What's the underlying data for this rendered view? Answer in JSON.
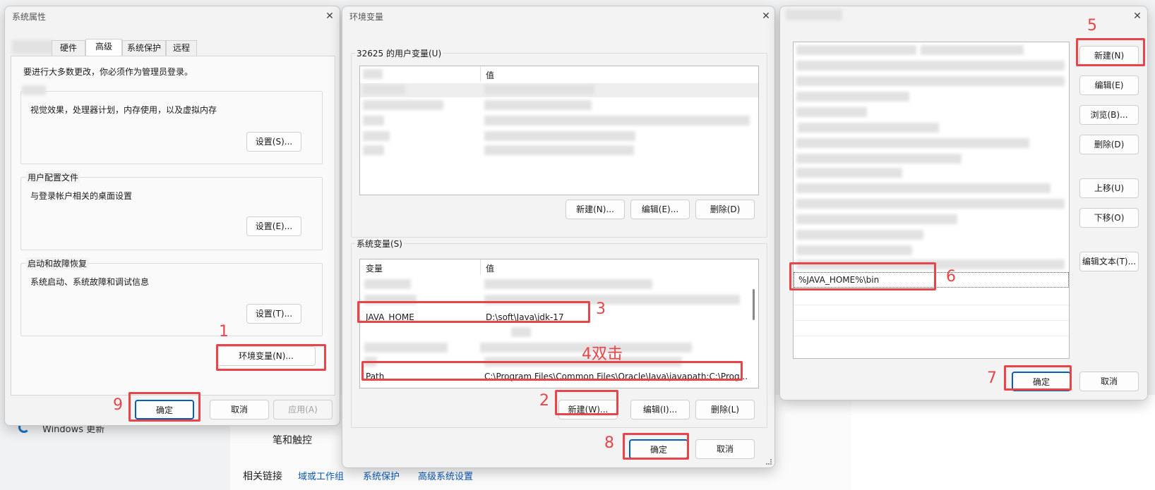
{
  "background": {
    "bg_nav_item": "Windows 更新",
    "bg_pen": "笔和触控",
    "related_links": {
      "label": "相关链接",
      "links": [
        "域或工作组",
        "系统保护",
        "高级系统设置"
      ]
    }
  },
  "sysprops": {
    "title": "系统属性",
    "tabs": [
      "硬件",
      "高级",
      "系统保护",
      "远程"
    ],
    "admin_note": "要进行大多数更改，你必须作为管理员登录。",
    "perf_desc": "视觉效果，处理器计划，内存使用，以及虚拟内存",
    "perf_btn": "设置(S)...",
    "profile_title": "用户配置文件",
    "profile_desc": "与登录帐户相关的桌面设置",
    "profile_btn": "设置(E)...",
    "startup_title": "启动和故障恢复",
    "startup_desc": "系统启动、系统故障和调试信息",
    "startup_btn": "设置(T)...",
    "env_btn": "环境变量(N)...",
    "ok": "确定",
    "cancel": "取消",
    "apply": "应用(A)"
  },
  "envvars": {
    "title": "环境变量",
    "user_title": "32625 的用户变量(U)",
    "user_col_value": "值",
    "user_new": "新建(N)...",
    "user_edit": "编辑(E)...",
    "user_delete": "删除(D)",
    "sys_title": "系统变量(S)",
    "sys_col_var": "变量",
    "sys_col_value": "值",
    "java_home_name": "JAVA_HOME",
    "java_home_value": "D:\\soft\\Java\\jdk-17",
    "path_name": "Path",
    "path_value": "C:\\Program Files\\Common Files\\Oracle\\Java\\javapath;C:\\Prog...",
    "sys_new": "新建(W)...",
    "sys_edit": "编辑(I)...",
    "sys_delete": "删除(L)",
    "ok": "确定",
    "cancel": "取消"
  },
  "editpath": {
    "new_entry": "%JAVA_HOME%\\bin",
    "new": "新建(N)",
    "edit": "编辑(E)",
    "browse": "浏览(B)...",
    "delete": "删除(D)",
    "move_up": "上移(U)",
    "move_down": "下移(O)",
    "edit_text": "编辑文本(T)...",
    "ok": "确定",
    "cancel": "取消"
  },
  "annotations": {
    "m1": "1",
    "m2": "2",
    "m3": "3",
    "m4": "4双击",
    "m5": "5",
    "m6": "6",
    "m7": "7",
    "m8": "8",
    "m9": "9",
    "color": "#e8454a"
  }
}
